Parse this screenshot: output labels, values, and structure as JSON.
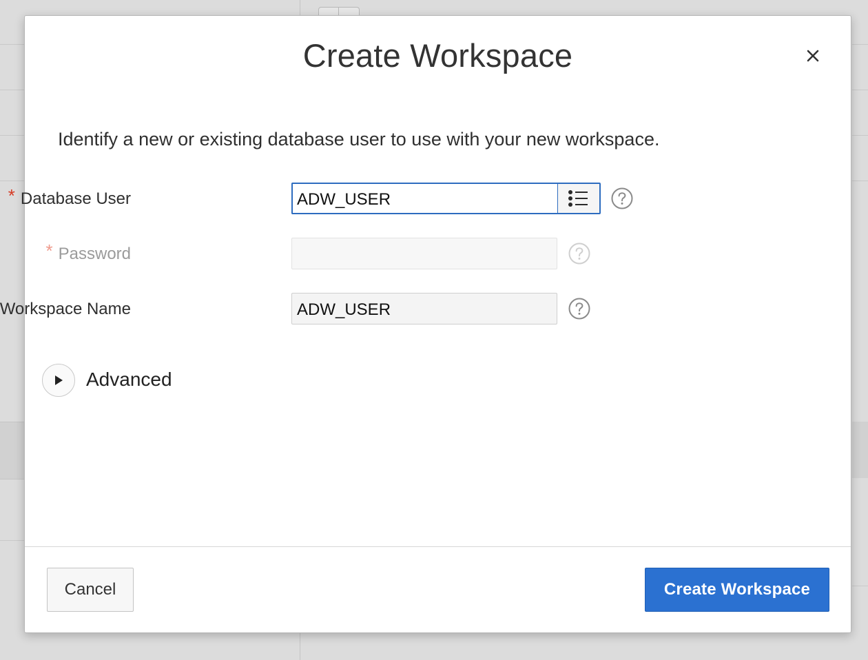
{
  "dialog": {
    "title": "Create Workspace",
    "close_icon": "close-icon",
    "intro": "Identify a new or existing database user to use with your new workspace.",
    "fields": {
      "database_user": {
        "label": "Database User",
        "value": "ADW_USER",
        "required": true,
        "lov_icon": "list-icon",
        "help_icon": "help-icon"
      },
      "password": {
        "label": "Password",
        "value": "",
        "required": true,
        "disabled": true,
        "help_icon": "help-icon"
      },
      "workspace_name": {
        "label": "Workspace Name",
        "value": "ADW_USER",
        "required": true,
        "help_icon": "help-icon"
      }
    },
    "required_marker": "*",
    "advanced": {
      "label": "Advanced",
      "icon": "triangle-right-icon",
      "expanded": false
    },
    "buttons": {
      "cancel": "Cancel",
      "create": "Create Workspace"
    }
  },
  "colors": {
    "primary": "#2b71d1",
    "required": "#d63b25",
    "focus": "#2d6cbf"
  }
}
